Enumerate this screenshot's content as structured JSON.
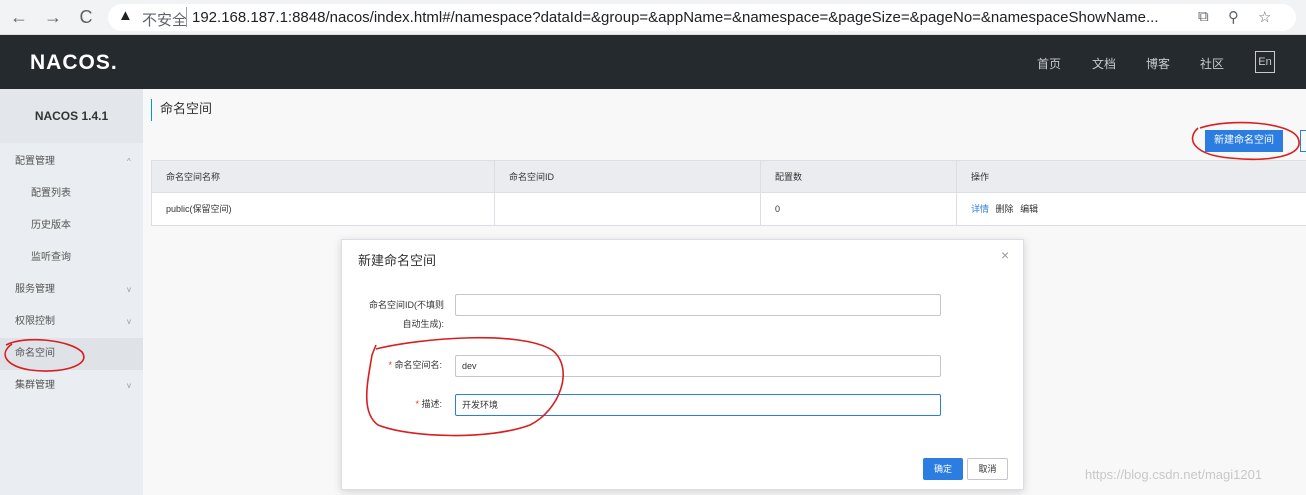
{
  "browser": {
    "back_icon": "←",
    "forward_icon": "→",
    "reload_icon": "C",
    "warning_icon": "▲",
    "insecure_text": "不安全",
    "url": "192.168.187.1:8848/nacos/index.html#/namespace?dataId=&group=&appName=&namespace=&pageSize=&pageNo=&namespaceShowName...",
    "translate_icon": "⧉",
    "zoom_icon": "⚲",
    "star_icon": "☆"
  },
  "header": {
    "logo": "NACOS.",
    "nav": [
      "首页",
      "文档",
      "博客",
      "社区"
    ],
    "lang": "En"
  },
  "sidebar": {
    "version": "NACOS 1.4.1",
    "items": [
      {
        "label": "配置管理",
        "chevron": "^"
      },
      {
        "label": "配置列表"
      },
      {
        "label": "历史版本"
      },
      {
        "label": "监听查询"
      },
      {
        "label": "服务管理",
        "chevron": "v"
      },
      {
        "label": "权限控制",
        "chevron": "v"
      },
      {
        "label": "命名空间"
      },
      {
        "label": "集群管理",
        "chevron": "v"
      }
    ]
  },
  "main": {
    "title": "命名空间",
    "new_button": "新建命名空间",
    "table": {
      "columns": [
        "命名空间名称",
        "命名空间ID",
        "配置数",
        "操作"
      ],
      "rows": [
        {
          "name": "public(保留空间)",
          "id": "",
          "count": "0",
          "ops": [
            "详情",
            "删除",
            "编辑"
          ]
        }
      ]
    }
  },
  "modal": {
    "title": "新建命名空间",
    "close_icon": "×",
    "fields": [
      {
        "label_line1": "命名空间ID(不填则",
        "label_line2": "自动生成):",
        "value": ""
      },
      {
        "required": "*",
        "label": "命名空间名:",
        "value": "dev"
      },
      {
        "required": "*",
        "label": "描述:",
        "value": "开发环境"
      }
    ],
    "ok": "确定",
    "cancel": "取消"
  },
  "watermark": "https://blog.csdn.net/magi1201"
}
